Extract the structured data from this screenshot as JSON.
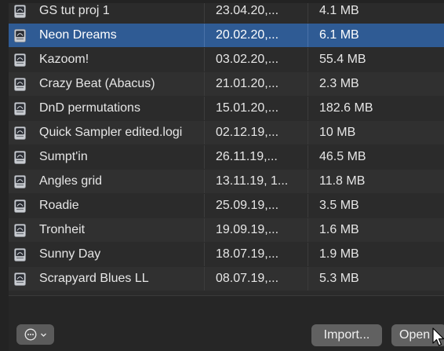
{
  "files": [
    {
      "name": "GS tut proj 1",
      "date": "23.04.20,...",
      "size": "4.1 MB",
      "selected": false
    },
    {
      "name": "Neon Dreams",
      "date": "20.02.20,...",
      "size": "6.1 MB",
      "selected": true
    },
    {
      "name": "Kazoom!",
      "date": "03.02.20,...",
      "size": "55.4 MB",
      "selected": false
    },
    {
      "name": "Crazy Beat (Abacus)",
      "date": "21.01.20,...",
      "size": "2.3 MB",
      "selected": false
    },
    {
      "name": "DnD permutations",
      "date": "15.01.20,...",
      "size": "182.6 MB",
      "selected": false
    },
    {
      "name": "Quick Sampler edited.logi",
      "date": "02.12.19,...",
      "size": "10 MB",
      "selected": false
    },
    {
      "name": "Sumpt'in",
      "date": "26.11.19,...",
      "size": "46.5 MB",
      "selected": false
    },
    {
      "name": "Angles grid",
      "date": "13.11.19, 1...",
      "size": "11.8 MB",
      "selected": false
    },
    {
      "name": "Roadie",
      "date": "25.09.19,...",
      "size": "3.5 MB",
      "selected": false
    },
    {
      "name": "Tronheit",
      "date": "19.09.19,...",
      "size": "1.6 MB",
      "selected": false
    },
    {
      "name": "Sunny Day",
      "date": "18.07.19,...",
      "size": "1.9 MB",
      "selected": false
    },
    {
      "name": "Scrapyard Blues LL",
      "date": "08.07.19,...",
      "size": "5.3 MB",
      "selected": false
    }
  ],
  "file_icon": "logic-project-icon",
  "footer": {
    "action_icon": "ellipsis-circle-icon",
    "dropdown_icon": "chevron-down-icon",
    "import_label": "Import...",
    "open_label": "Open"
  },
  "colors": {
    "selection": "#2f5b94",
    "row": "#2b2b2b",
    "row_alt": "#303030"
  }
}
